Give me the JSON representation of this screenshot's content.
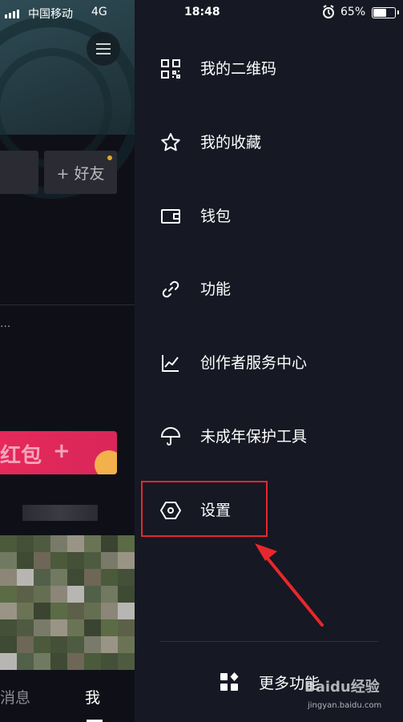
{
  "status_bar": {
    "carrier": "中国移动",
    "network": "4G",
    "time": "18:48",
    "battery": "65%",
    "battery_level": 0.65
  },
  "background_app": {
    "add_friend_label": "+ 好友",
    "ellipsis": "...",
    "red_packet_label": "红包",
    "red_packet_plus": "+",
    "tab_messages": "消息",
    "tab_me": "我"
  },
  "drawer": {
    "items": [
      {
        "label": "我的二维码",
        "icon": "qr-code-icon"
      },
      {
        "label": "我的收藏",
        "icon": "star-icon"
      },
      {
        "label": "钱包",
        "icon": "wallet-icon"
      },
      {
        "label": "功能",
        "icon": "link-icon"
      },
      {
        "label": "创作者服务中心",
        "icon": "chart-icon"
      },
      {
        "label": "未成年保护工具",
        "icon": "umbrella-icon"
      },
      {
        "label": "设置",
        "icon": "hexagon-settings-icon"
      }
    ],
    "more_label": "更多功能"
  },
  "annotation": {
    "highlight_color": "#e8272c"
  },
  "watermark": {
    "text": "Baidu经验",
    "url": "jingyan.baidu.com"
  }
}
